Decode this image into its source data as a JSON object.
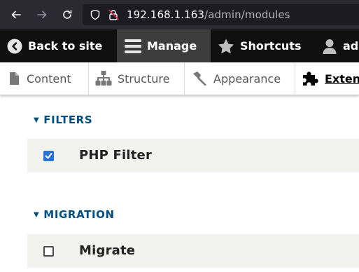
{
  "browser": {
    "url_host": "192.168.1.163",
    "url_path": "/admin/modules"
  },
  "toolbar": {
    "back_label": "Back to site",
    "manage_label": "Manage",
    "shortcuts_label": "Shortcuts",
    "user_label": "ad"
  },
  "tray": {
    "items": [
      {
        "label": "Content",
        "icon": "file-icon"
      },
      {
        "label": "Structure",
        "icon": "sitemap-icon"
      },
      {
        "label": "Appearance",
        "icon": "paintbrush-icon"
      },
      {
        "label": "Exten",
        "icon": "puzzle-icon",
        "active": true
      }
    ]
  },
  "sections": [
    {
      "title": "FILTERS",
      "modules": [
        {
          "name": "PHP Filter",
          "checked": true
        }
      ]
    },
    {
      "title": "MIGRATION",
      "modules": [
        {
          "name": "Migrate",
          "checked": false
        }
      ]
    }
  ],
  "colors": {
    "section_title": "#004f80",
    "checkbox_checked": "#2773d6",
    "toolbar_bg": "#0f0f0f",
    "toolbar_active_bg": "#3d3d3d",
    "row_bg": "#f2f2ef"
  }
}
